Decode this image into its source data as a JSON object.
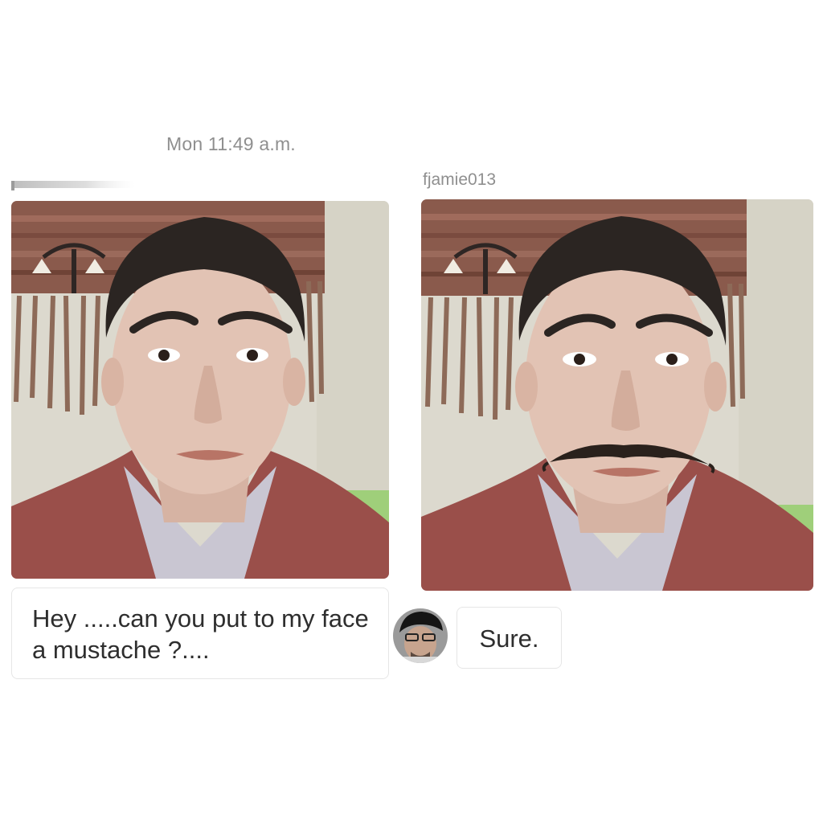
{
  "conversation": {
    "timestamp": "Mon 11:49 a.m.",
    "sender_name_redacted": true,
    "reply_username": "fjamie013"
  },
  "messages": [
    {
      "from": "requester",
      "kind": "photo",
      "description": "original-selfie"
    },
    {
      "from": "requester",
      "kind": "text",
      "text": "Hey .....can you put to my face a mustache ?...."
    },
    {
      "from": "fjamie013",
      "kind": "photo",
      "description": "edited-selfie-with-mustache"
    },
    {
      "from": "fjamie013",
      "kind": "text",
      "text": "Sure."
    }
  ],
  "colors": {
    "background": "#ffffff",
    "meta_text": "#8f8f8f",
    "message_text": "#2e2e2e",
    "bubble_border": "#e6e6e6",
    "shirt": "#9a4f4a",
    "wall": "#dedbd0",
    "tapestry": "#8a5a4c"
  }
}
